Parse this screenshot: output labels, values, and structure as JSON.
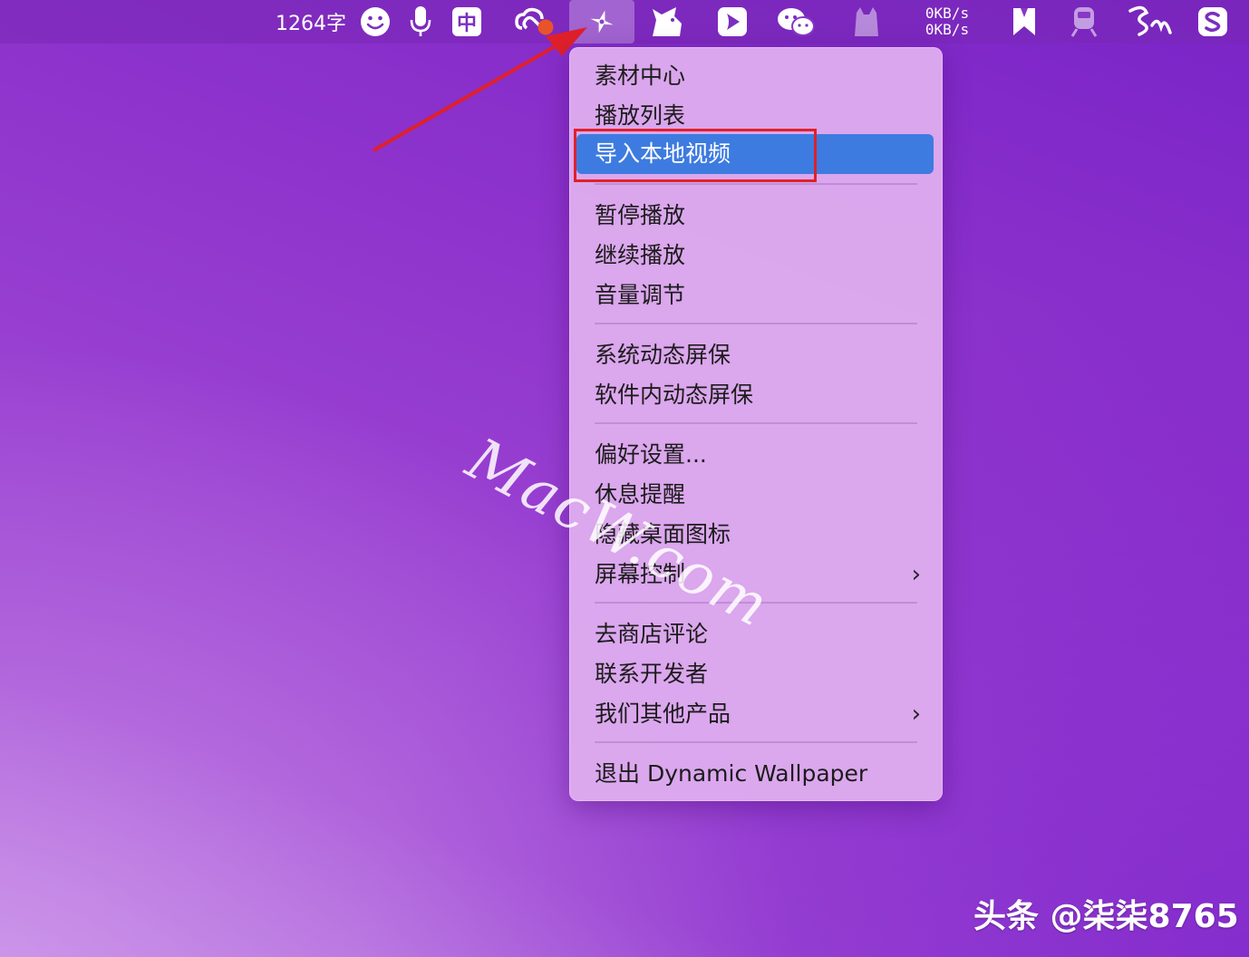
{
  "menubar": {
    "word_count": "1264字",
    "input_method": "中",
    "net_up": "0KB/s",
    "net_down": "0KB/s",
    "icons": [
      "smiley-icon",
      "microphone-icon",
      "input-method-icon",
      "creative-cloud-icon",
      "dynamic-wallpaper-icon",
      "dog-app-icon",
      "feishu-icon",
      "wechat-icon",
      "cat-app-icon",
      "network-speed",
      "bookmark-icon",
      "train-icon",
      "cursive-app-icon",
      "sogou-icon"
    ]
  },
  "menu": {
    "items": [
      {
        "label": "素材中心"
      },
      {
        "label": "播放列表"
      },
      {
        "label": "导入本地视频"
      },
      {
        "label": "暂停播放"
      },
      {
        "label": "继续播放"
      },
      {
        "label": "音量调节"
      },
      {
        "label": "系统动态屏保"
      },
      {
        "label": "软件内动态屏保"
      },
      {
        "label": "偏好设置..."
      },
      {
        "label": "休息提醒"
      },
      {
        "label": "隐藏桌面图标"
      },
      {
        "label": "屏幕控制"
      },
      {
        "label": "去商店评论"
      },
      {
        "label": "联系开发者"
      },
      {
        "label": "我们其他产品"
      },
      {
        "label": "退出 Dynamic Wallpaper"
      }
    ],
    "submenu_glyph": "›"
  },
  "watermark": "MacW.com",
  "credit": "头条 @柒柒8765",
  "colors": {
    "accent": "#3d7be0",
    "annotation": "#e0202a"
  }
}
